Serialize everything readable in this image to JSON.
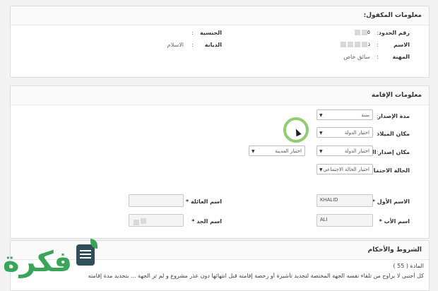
{
  "sponsored": {
    "title": "معلومات المكفول:",
    "border_label": "رقم الحدود",
    "border_value": "٥",
    "name_label": "الاسم",
    "name_value": "ذ",
    "job_label": "المهنة",
    "job_value": "سائق خاص",
    "nationality_label": "الجنسية",
    "nationality_value": "",
    "religion_label": "الديانة",
    "religion_value": "الاسلام",
    "colon": ":"
  },
  "residence": {
    "title": "معلومات الإقامة",
    "issue_period_label": "مدة الإصدار",
    "issue_period_value": "سنة",
    "birth_place_label": "مكان الميلاد",
    "birth_place_value": "اختيار الدولة",
    "passport_place_label": "مكان إصدار الجواز",
    "passport_country_value": "اختيار الدولة",
    "passport_city_value": "اختيار المدينة",
    "marital_label": "الحالة الاجتماعية",
    "marital_value": "اختيار الحالة الاجتماعي",
    "first_name_label": "الاسم الأول",
    "first_name_value": "KHALID",
    "family_name_label": "اسم العائلة",
    "family_name_value": "",
    "father_name_label": "اسم الأب",
    "father_name_value": "ALI",
    "grandfather_name_label": "اسم الجد",
    "grandfather_name_value": ""
  },
  "terms": {
    "title": "الشروط والأحكام",
    "article": "المادة ( 55 )",
    "text": "كل أجنبي لا يراوح من تلقاء نفسه الجهة المختصة لتجديد تأشيرة أو رخصة إقامته قبل انتهائها دون عذر مشروع و لم تر الجهة ... بتجديد مدة إقامته"
  },
  "logo": {
    "text": "فكرة"
  }
}
